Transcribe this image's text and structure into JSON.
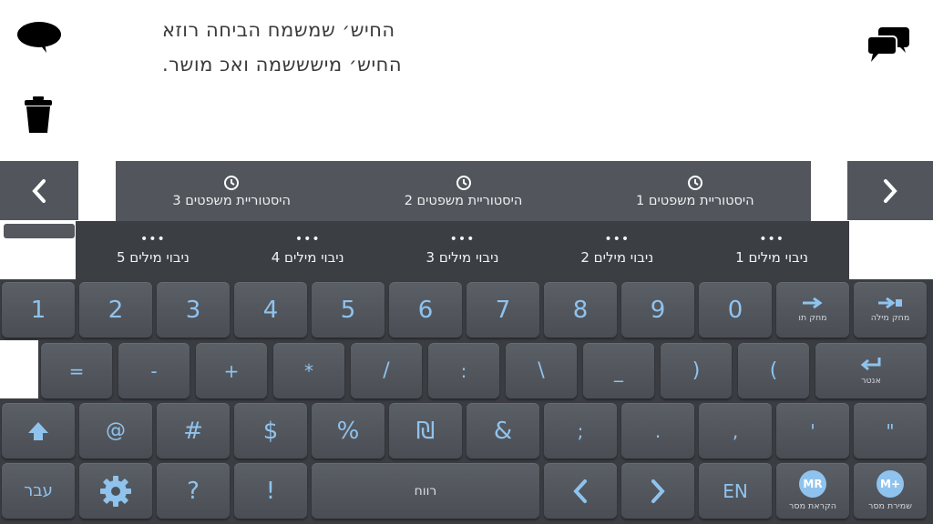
{
  "message": {
    "line1": "החיש׳ שמשמח הביחה רוזא",
    "line2": "החיש׳ מישששמה ואכ מושר."
  },
  "icons": {
    "speak": "speech-bubble-icon",
    "clear": "trash-icon",
    "conversation": "conversation-icon"
  },
  "history": {
    "items": [
      {
        "label": "היסטוריית משפטים 1"
      },
      {
        "label": "היסטוריית משפטים 2"
      },
      {
        "label": "היסטוריית משפטים 3"
      }
    ]
  },
  "levels": {
    "dots": "•••",
    "items": [
      {
        "label": "ניבוי מילים 1"
      },
      {
        "label": "ניבוי מילים 2"
      },
      {
        "label": "ניבוי מילים 3"
      },
      {
        "label": "ניבוי מילים 4"
      },
      {
        "label": "ניבוי מילים 5"
      }
    ]
  },
  "keys": {
    "row1": [
      "1",
      "2",
      "3",
      "4",
      "5",
      "6",
      "7",
      "8",
      "9",
      "0"
    ],
    "delete_word": "מחק מילה",
    "delete_char": "מחק תו",
    "row2": [
      "=",
      "-",
      "+",
      "*",
      "/",
      ":",
      "\\",
      "_",
      ")",
      "("
    ],
    "enter": "אנטר",
    "row3": [
      "@",
      "#",
      "$",
      "%",
      "₪",
      "&",
      ";",
      ".",
      ",",
      "'",
      "\""
    ],
    "question": "?",
    "exclaim": "!",
    "space": "רווח",
    "lang_he": "עבר",
    "lang_en": "EN",
    "read_label": "הקראת מסר",
    "read_badge": "MR",
    "save_label": "שמירת מסר",
    "save_badge": "M+"
  },
  "colors": {
    "accent": "#8fc3ee",
    "keyboard_bg": "#3a3d42",
    "history_bg": "#52565c"
  }
}
